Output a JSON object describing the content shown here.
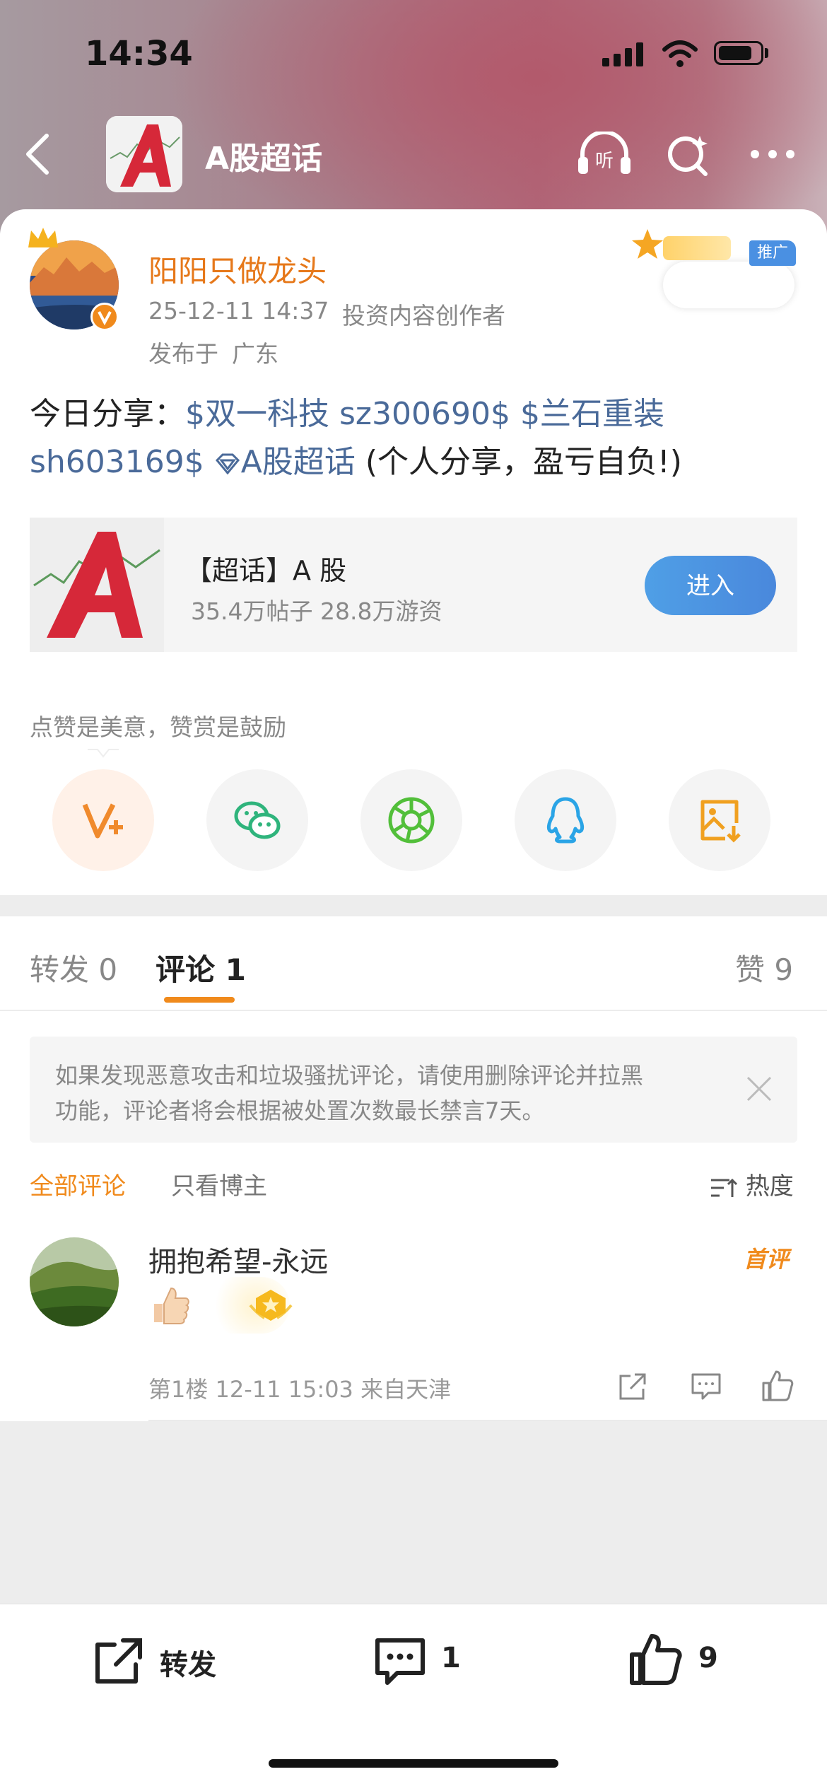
{
  "status_bar": {
    "time": "14:34"
  },
  "header": {
    "title": "A股超话"
  },
  "post": {
    "author": "阳阳只做龙头",
    "timestamp": "25-12-11 14:37",
    "author_role": "投资内容创作者",
    "location_prefix": "发布于",
    "location": "广东",
    "text_prefix": "今日分享：",
    "stock1": "$双一科技 sz300690$",
    "stock2": "$兰石重装",
    "stock2b": "sh603169$",
    "topic_link": "A股超话",
    "text_suffix": "(个人分享，盈亏自负!)",
    "promo_badge": "推广"
  },
  "topic_card": {
    "title": "【超话】A 股",
    "stats": "35.4万帖子 28.8万游资",
    "enter_label": "进入"
  },
  "reward_hint": "点赞是美意，赞赏是鼓励",
  "share_icons": [
    "v-plus-icon",
    "wechat-icon",
    "moments-icon",
    "qq-icon",
    "save-image-icon"
  ],
  "tabs": {
    "repost_label": "转发",
    "repost_count": "0",
    "comment_label": "评论",
    "comment_count": "1",
    "like_label": "赞",
    "like_count": "9"
  },
  "notice": {
    "line1": "如果发现恶意攻击和垃圾骚扰评论，请使用删除评论并拉黑",
    "line2": "功能，评论者将会根据被处置次数最长禁言7天。"
  },
  "filters": {
    "all": "全部评论",
    "author_only": "只看博主",
    "sort": "热度"
  },
  "comment": {
    "user": "拥抱希望-永远",
    "badge": "首评",
    "meta": "第1楼 12-11 15:03 来自天津"
  },
  "bottom_bar": {
    "repost_label": "转发",
    "comment_count": "1",
    "like_count": "9"
  },
  "colors": {
    "accent_orange": "#e6781a",
    "link_blue": "#4a6a99",
    "button_blue": "#4a90e2"
  }
}
